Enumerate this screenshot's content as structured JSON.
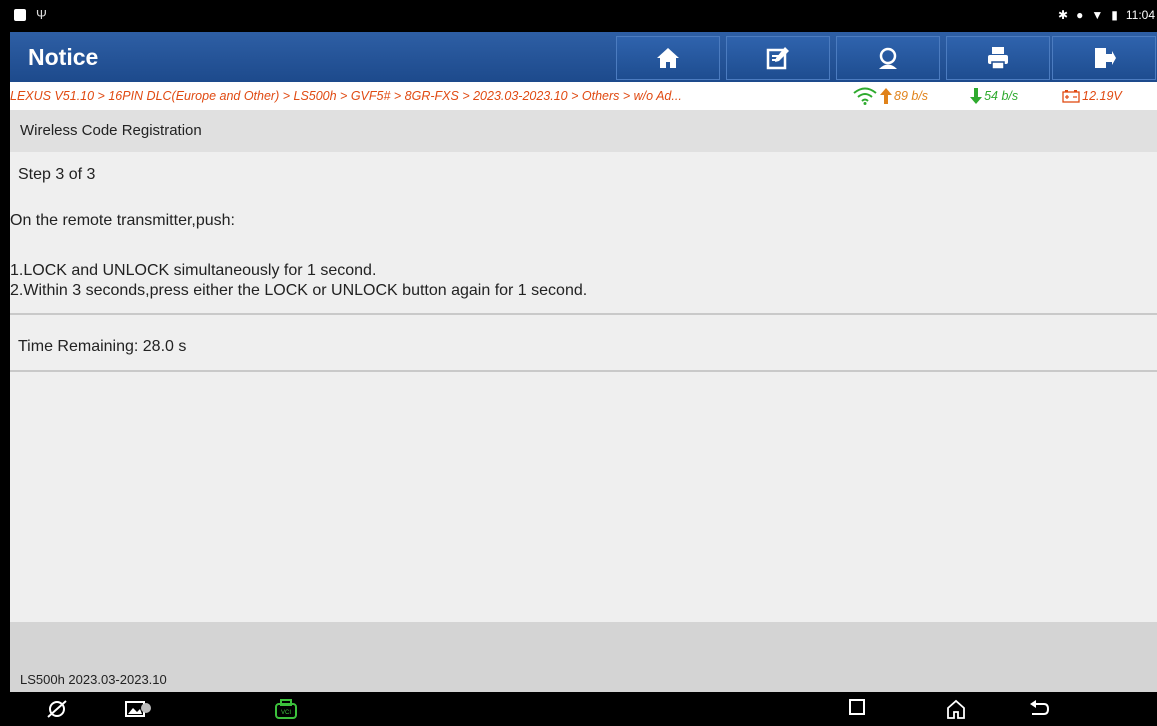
{
  "statusbar": {
    "time": "11:04"
  },
  "titlebar": {
    "title": "Notice",
    "buttons": [
      "home-icon",
      "edit-icon",
      "support-icon",
      "print-icon",
      "exit-icon"
    ]
  },
  "breadcrumb": {
    "path": "LEXUS V51.10 > 16PIN DLC(Europe and Other) > LS500h > GVF5# > 8GR-FXS > 2023.03-2023.10 > Others > w/o Ad...",
    "upload": "89 b/s",
    "download": "54 b/s",
    "voltage": "12.19V"
  },
  "section": {
    "title": "Wireless Code Registration"
  },
  "content": {
    "step": "Step 3 of 3",
    "instruction": "On the remote transmitter,push:",
    "line1": "1.LOCK and UNLOCK simultaneously for 1 second.",
    "line2": "2.Within 3 seconds,press either the LOCK or UNLOCK button again for 1 second.",
    "timer": "Time Remaining: 28.0 s"
  },
  "footer": {
    "vehicle": "LS500h 2023.03-2023.10"
  },
  "colors": {
    "titlebar": "#2e5fa5",
    "breadcrumb_text": "#e04a12",
    "upload": "#e0821a",
    "download": "#2eaa2e"
  }
}
